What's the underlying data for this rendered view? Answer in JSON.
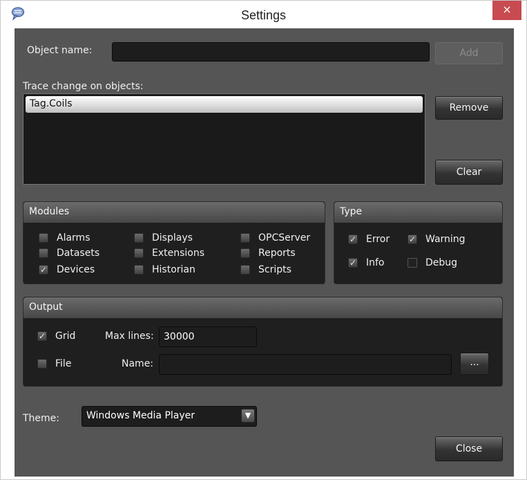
{
  "window": {
    "title": "Settings",
    "close_glyph": "×",
    "app_icon": "speech-bubble-icon",
    "close_color": "#c74b50"
  },
  "object_name": {
    "label": "Object name:",
    "value": "",
    "add_label": "Add"
  },
  "trace": {
    "label": "Trace change on objects:",
    "items": [
      "Tag.Coils"
    ],
    "remove_label": "Remove",
    "clear_label": "Clear"
  },
  "modules": {
    "title": "Modules",
    "items": [
      {
        "label": "Alarms",
        "checked": false
      },
      {
        "label": "Datasets",
        "checked": false
      },
      {
        "label": "Devices",
        "checked": true
      },
      {
        "label": "Displays",
        "checked": false
      },
      {
        "label": "Extensions",
        "checked": false
      },
      {
        "label": "Historian",
        "checked": false
      },
      {
        "label": "OPCServer",
        "checked": false
      },
      {
        "label": "Reports",
        "checked": false
      },
      {
        "label": "Scripts",
        "checked": false
      }
    ]
  },
  "type": {
    "title": "Type",
    "items": [
      {
        "label": "Error",
        "checked": true
      },
      {
        "label": "Warning",
        "checked": true
      },
      {
        "label": "Info",
        "checked": true
      },
      {
        "label": "Debug",
        "checked": false
      }
    ]
  },
  "output": {
    "title": "Output",
    "grid_label": "Grid",
    "grid_checked": true,
    "max_lines_label": "Max lines:",
    "max_lines_value": "30000",
    "file_label": "File",
    "file_checked": false,
    "name_label": "Name:",
    "name_value": "",
    "browse_label": "..."
  },
  "theme": {
    "label": "Theme:",
    "selected": "Windows Media Player"
  },
  "close_label": "Close"
}
